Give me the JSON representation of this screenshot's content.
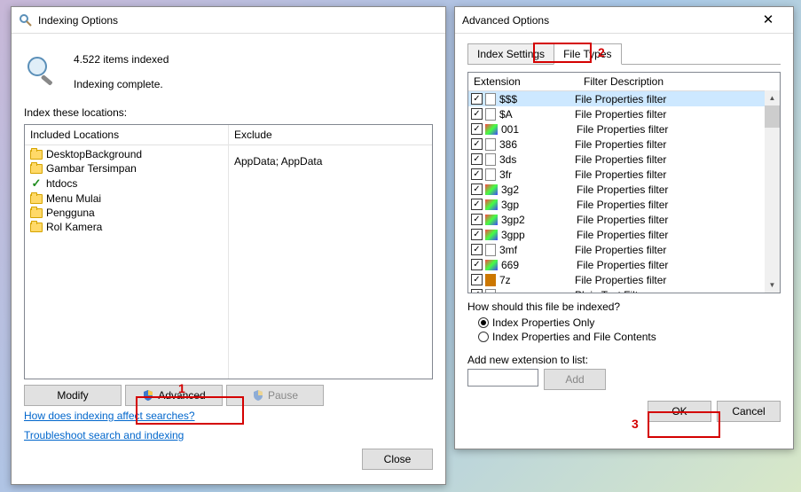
{
  "w1": {
    "title": "Indexing Options",
    "items_indexed": "4.522 items indexed",
    "status": "Indexing complete.",
    "index_these": "Index these locations:",
    "col_included": "Included Locations",
    "col_exclude": "Exclude",
    "locations": [
      {
        "name": "DesktopBackground",
        "icon": "folder"
      },
      {
        "name": "Gambar Tersimpan",
        "icon": "folder"
      },
      {
        "name": "htdocs",
        "icon": "check"
      },
      {
        "name": "Menu Mulai",
        "icon": "folder"
      },
      {
        "name": "Pengguna",
        "icon": "folder"
      },
      {
        "name": "Rol Kamera",
        "icon": "folder"
      }
    ],
    "exclude_values": [
      "",
      "",
      "",
      "",
      "AppData; AppData",
      ""
    ],
    "btn_modify": "Modify",
    "btn_advanced": "Advanced",
    "btn_pause": "Pause",
    "link_how": "How does indexing affect searches?",
    "link_trouble": "Troubleshoot search and indexing",
    "btn_close": "Close"
  },
  "w2": {
    "title": "Advanced Options",
    "tab1": "Index Settings",
    "tab2": "File Types",
    "col_ext": "Extension",
    "col_desc": "Filter Description",
    "rows": [
      {
        "ext": "$$$",
        "desc": "File Properties filter",
        "icon": "file",
        "sel": true
      },
      {
        "ext": "$A",
        "desc": "File Properties filter",
        "icon": "file"
      },
      {
        "ext": "001",
        "desc": "File Properties filter",
        "icon": "img"
      },
      {
        "ext": "386",
        "desc": "File Properties filter",
        "icon": "file"
      },
      {
        "ext": "3ds",
        "desc": "File Properties filter",
        "icon": "file"
      },
      {
        "ext": "3fr",
        "desc": "File Properties filter",
        "icon": "file"
      },
      {
        "ext": "3g2",
        "desc": "File Properties filter",
        "icon": "img"
      },
      {
        "ext": "3gp",
        "desc": "File Properties filter",
        "icon": "img"
      },
      {
        "ext": "3gp2",
        "desc": "File Properties filter",
        "icon": "img"
      },
      {
        "ext": "3gpp",
        "desc": "File Properties filter",
        "icon": "img"
      },
      {
        "ext": "3mf",
        "desc": "File Properties filter",
        "icon": "file"
      },
      {
        "ext": "669",
        "desc": "File Properties filter",
        "icon": "img"
      },
      {
        "ext": "7z",
        "desc": "File Properties filter",
        "icon": "arc"
      },
      {
        "ext": "a",
        "desc": "Plain Text Filter",
        "icon": "file"
      }
    ],
    "question": "How should this file be indexed?",
    "r1": "Index Properties Only",
    "r2": "Index Properties and File Contents",
    "add_label": "Add new extension to list:",
    "btn_add": "Add",
    "btn_ok": "OK",
    "btn_cancel": "Cancel"
  },
  "annot": {
    "n1": "1",
    "n2": "2",
    "n3": "3"
  }
}
